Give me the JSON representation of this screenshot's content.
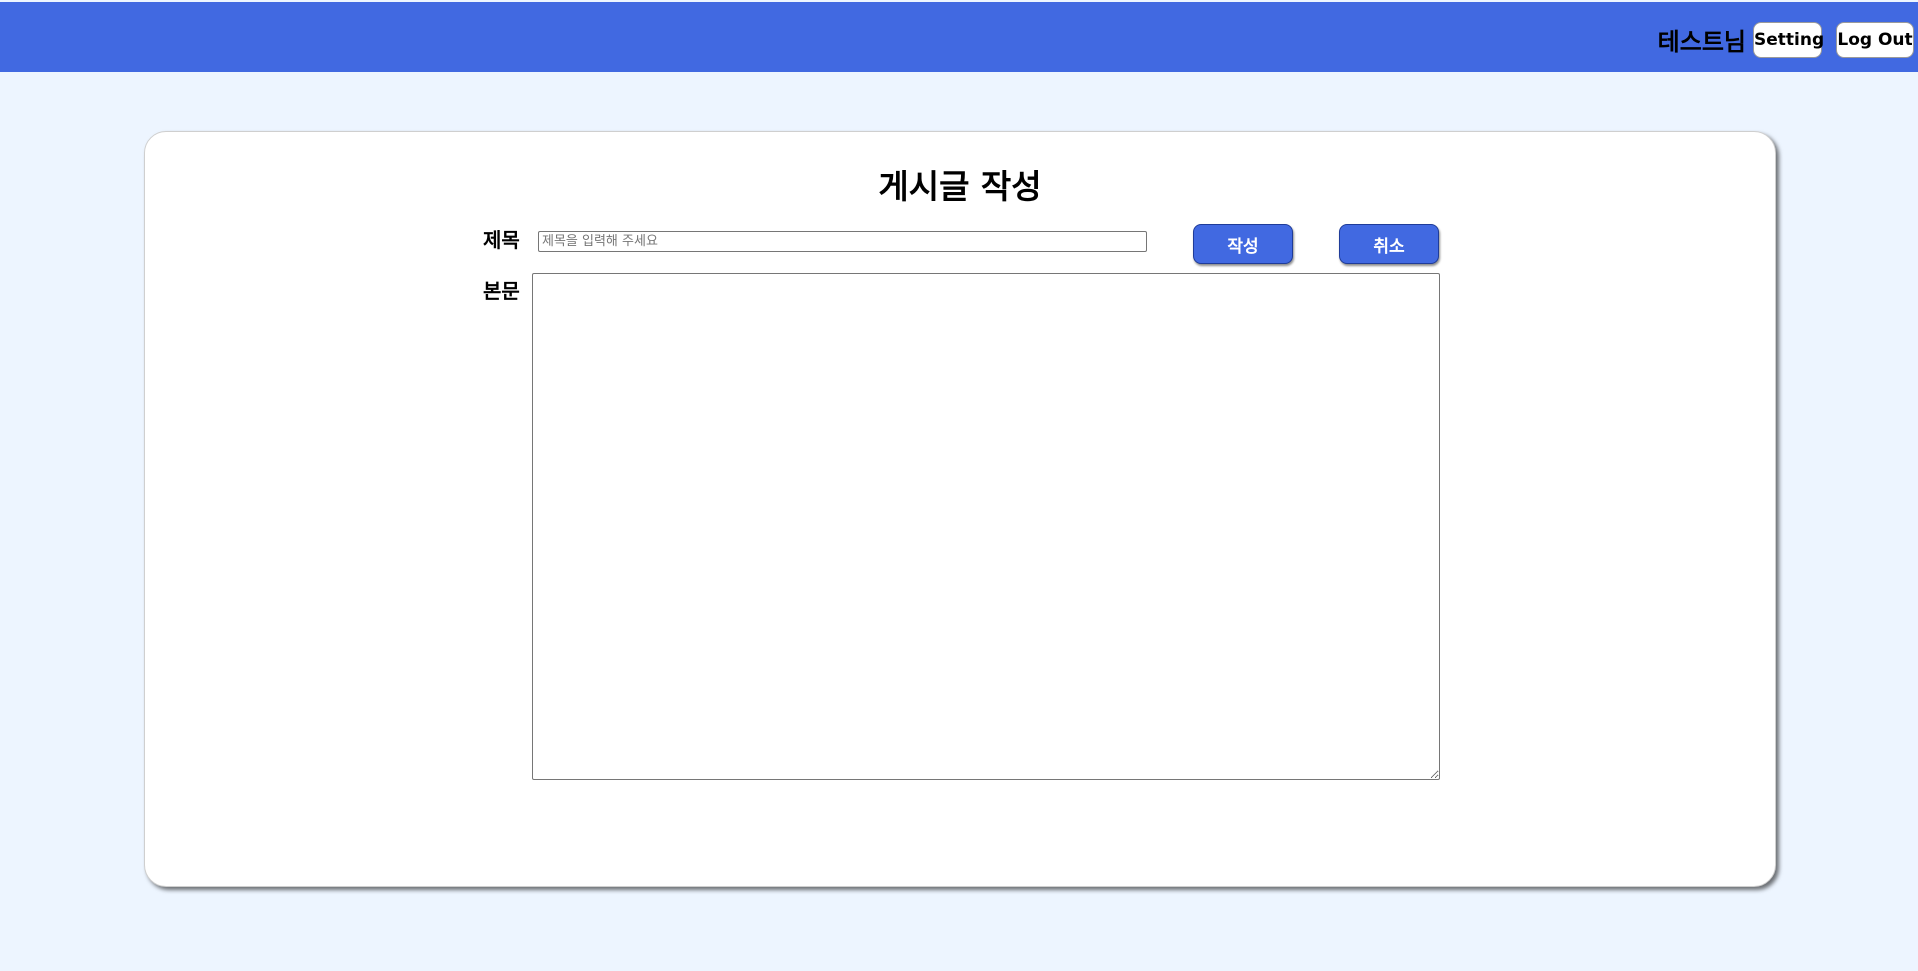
{
  "header": {
    "user_name": "테스트님",
    "setting_label": "Setting",
    "logout_label": "Log Out"
  },
  "form": {
    "title": "게시글 작성",
    "title_label": "제목",
    "title_input": {
      "value": "",
      "placeholder": "제목을 입력해 주세요"
    },
    "body_label": "본문",
    "body_value": "",
    "submit_label": "작성",
    "cancel_label": "취소"
  },
  "colors": {
    "header_bg": "#4169e1",
    "page_bg": "#edf5ff",
    "button_bg": "#4169e1"
  }
}
